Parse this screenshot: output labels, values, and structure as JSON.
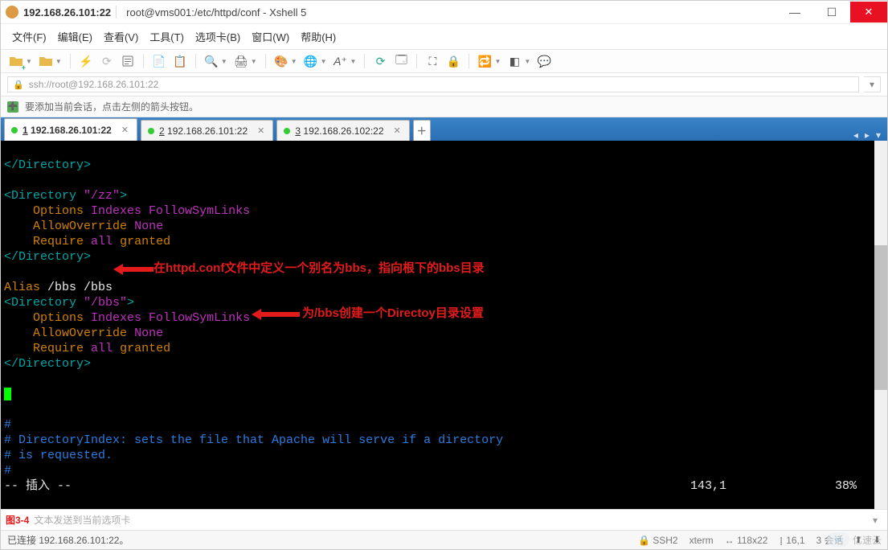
{
  "titlebar": {
    "ip": "192.168.26.101:22",
    "path": "root@vms001:/etc/httpd/conf - Xshell 5"
  },
  "menubar": [
    "文件(F)",
    "编辑(E)",
    "查看(V)",
    "工具(T)",
    "选项卡(B)",
    "窗口(W)",
    "帮助(H)"
  ],
  "addressbar": {
    "url": "ssh://root@192.168.26.101:22"
  },
  "hintbar": {
    "text": "要添加当前会话，点击左侧的箭头按钮。"
  },
  "tabs": [
    {
      "prefix": "1",
      "label": "192.168.26.101:22",
      "active": true
    },
    {
      "prefix": "2",
      "label": "192.168.26.101:22",
      "active": false
    },
    {
      "prefix": "3",
      "label": "192.168.26.102:22",
      "active": false
    }
  ],
  "term": {
    "l0": "</Directory>",
    "l1a": "<Directory",
    "l1b": "\"/zz\"",
    "l1c": ">",
    "l2a": "Options",
    "l2b": "Indexes FollowSymLinks",
    "l3a": "AllowOverride",
    "l3b": "None",
    "l4a": "Require",
    "l4b": "all",
    "l4c": "granted",
    "l5": "</Directory>",
    "l6a": "Alias",
    "l6b": "/bbs /bbs",
    "l7a": "<Directory",
    "l7b": "\"/bbs\"",
    "l7c": ">",
    "l8a": "Options",
    "l8b": "Indexes FollowSymLinks",
    "l9a": "AllowOverride",
    "l9b": "None",
    "l10a": "Require",
    "l10b": "all",
    "l10c": "granted",
    "l11": "</Directory>",
    "l12": "#",
    "l13": "# DirectoryIndex: sets the file that Apache will serve if a directory",
    "l14": "# is requested.",
    "l15": "#",
    "l16_mode": "-- 插入 --",
    "l16_pos": "143,1",
    "l16_pct": "38%"
  },
  "annotations": [
    {
      "text": "在httpd.conf文件中定义一个别名为bbs，指向根下的bbs目录"
    },
    {
      "text": "为/bbs创建一个Directoy目录设置"
    }
  ],
  "inputbar": {
    "figure_label": "图3-4",
    "placeholder": "文本发送到当前选项卡"
  },
  "status": {
    "connected": "已连接 192.168.26.101:22。",
    "protocol": "SSH2",
    "termtype": "xterm",
    "size": "118x22",
    "cursor": "16,1",
    "sessions": "3 会话"
  },
  "watermark": {
    "text": "亿速云"
  }
}
